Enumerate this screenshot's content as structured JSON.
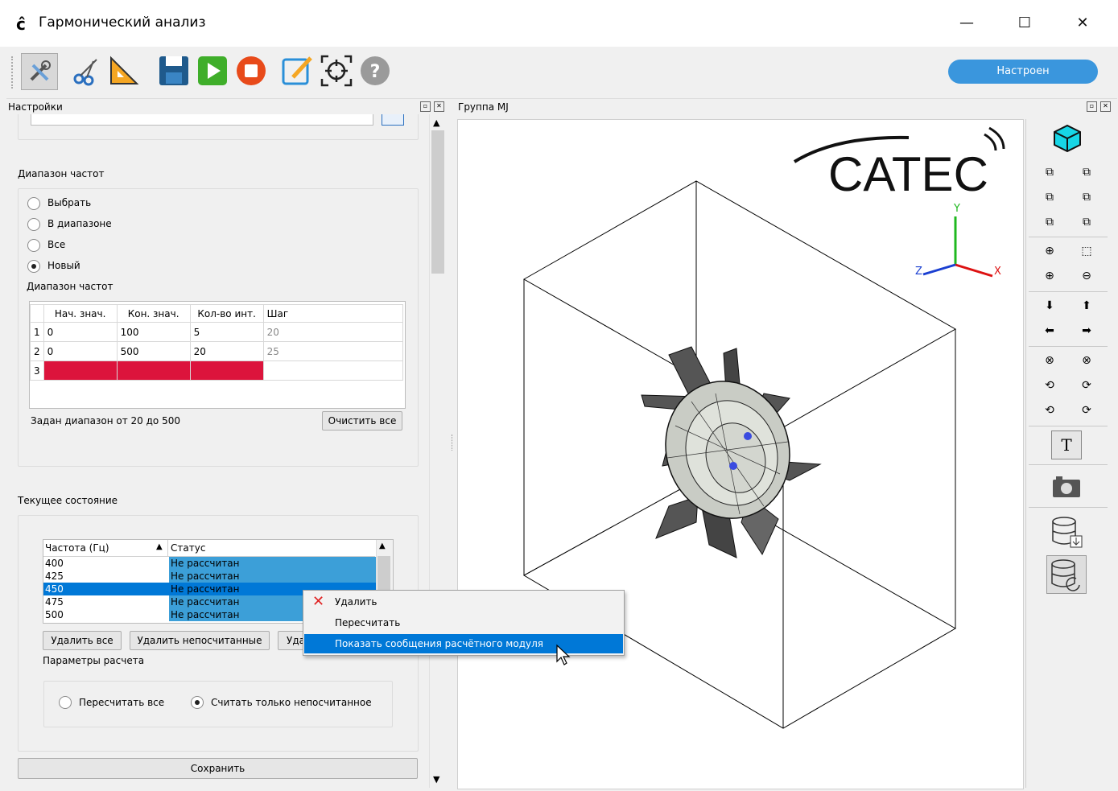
{
  "window": {
    "title": "Гармонический анализ",
    "logo_glyph": "ĉ",
    "minimize": "—",
    "maximize": "☐",
    "close": "✕"
  },
  "toolbar": {
    "status_label": "Настроен",
    "icons": [
      "tools-icon",
      "scissors-icon",
      "ruler-icon",
      "save-icon",
      "run-icon",
      "stop-icon",
      "edit-icon",
      "target-icon",
      "help-icon"
    ]
  },
  "left_dock": {
    "title": "Настройки"
  },
  "freq_range": {
    "section_title": "Диапазон частот",
    "options": [
      "Выбрать",
      "В диапазоне",
      "Все",
      "Новый"
    ],
    "selected": "Новый",
    "table_title": "Диапазон частот",
    "columns": [
      "Нач. знач.",
      "Кон. знач.",
      "Кол-во инт.",
      "Шаг"
    ],
    "rows": [
      {
        "n": "1",
        "start": "0",
        "end": "100",
        "count": "5",
        "step": "20"
      },
      {
        "n": "2",
        "start": "0",
        "end": "500",
        "count": "20",
        "step": "25"
      },
      {
        "n": "3",
        "start": "",
        "end": "",
        "count": "",
        "step": ""
      }
    ],
    "summary": "Задан диапазон от 20 до 500",
    "clear_label": "Очистить все"
  },
  "state": {
    "section_title": "Текущее состояние",
    "columns": [
      "Частота (Гц)",
      "Статус"
    ],
    "rows": [
      {
        "freq": "400",
        "status": "Не рассчитан"
      },
      {
        "freq": "425",
        "status": "Не рассчитан"
      },
      {
        "freq": "450",
        "status": "Не рассчитан"
      },
      {
        "freq": "475",
        "status": "Не рассчитан"
      },
      {
        "freq": "500",
        "status": "Не рассчитан"
      }
    ],
    "selected_row": "450",
    "delete_all": "Удалить все",
    "delete_uncalc": "Удалить непосчитанные",
    "third_button": "Уда",
    "params_title": "Параметры расчета",
    "recalc_all": "Пересчитать все",
    "calc_only_new": "Считать только непосчитанное",
    "selected_param": "Считать только непосчитанное",
    "save_label": "Сохранить"
  },
  "context_menu": {
    "items": [
      "Удалить",
      "Пересчитать",
      "Показать сообщения расчётного модуля"
    ],
    "highlighted": "Показать сообщения расчётного модуля"
  },
  "viewport": {
    "dock_title": "Группа MJ",
    "brand": "CATEC",
    "axis_x": "X",
    "axis_y": "Y",
    "axis_z": "Z"
  },
  "right_toolbar": {
    "text_tool": "T"
  }
}
